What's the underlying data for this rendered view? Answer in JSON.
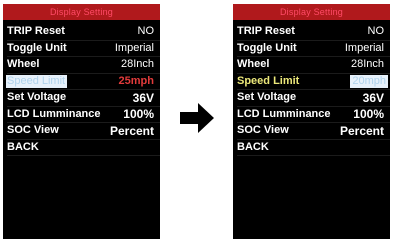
{
  "left_screen": {
    "title": "Display Setting",
    "items": [
      {
        "label": "TRIP Reset",
        "value": "NO"
      },
      {
        "label": "Toggle Unit",
        "value": "Imperial"
      },
      {
        "label": "Wheel",
        "value": "28Inch"
      },
      {
        "label": "Speed Limit",
        "value": "25mph"
      },
      {
        "label": "Set Voltage",
        "value": "36V"
      },
      {
        "label": "LCD Lumminance",
        "value": "100%"
      },
      {
        "label": "SOC View",
        "value": "Percent"
      },
      {
        "label": "BACK",
        "value": ""
      }
    ]
  },
  "right_screen": {
    "title": "Display Setting",
    "items": [
      {
        "label": "TRIP Reset",
        "value": "NO"
      },
      {
        "label": "Toggle Unit",
        "value": "Imperial"
      },
      {
        "label": "Wheel",
        "value": "28Inch"
      },
      {
        "label": "Speed Limit",
        "value": "20mph"
      },
      {
        "label": "Set Voltage",
        "value": "36V"
      },
      {
        "label": "LCD Lumminance",
        "value": "100%"
      },
      {
        "label": "SOC View",
        "value": "Percent"
      },
      {
        "label": "BACK",
        "value": ""
      }
    ]
  },
  "colors": {
    "screen_bg": "#000000",
    "title_bar": "#b0191c",
    "title_text": "#ff4a66",
    "selection_highlight": "#e7f1fb",
    "selected_text": "#b0d3ec",
    "edit_value_red": "#e23b3b",
    "editing_label_yellow": "#ece87a",
    "arrow": "#000000"
  },
  "icons": {
    "transition": "right-arrow-icon"
  }
}
